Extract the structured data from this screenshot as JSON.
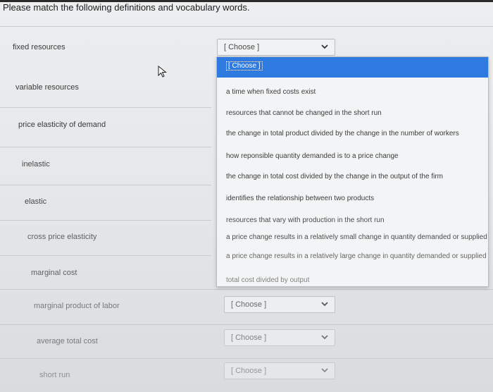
{
  "question": "Please match the following definitions and vocabulary words.",
  "terms": [
    "fixed resources",
    "variable resources",
    "price elasticity of demand",
    "inelastic",
    "elastic",
    "cross price elasticity",
    "marginal cost",
    "marginal product of labor",
    "average total cost",
    "short run"
  ],
  "select_placeholder": "[ Choose ]",
  "dropdown_options": [
    "[ Choose ]",
    "a time when fixed costs exist",
    "resources that cannot be changed in the short run",
    "the change in total product divided by the change in the number of workers",
    "how reponsible quantity demanded is to a price change",
    "the change in total cost divided by the change in the output of the firm",
    "identifies the relationship between two products",
    "resources that vary with production in the short run",
    "a price change results in a relatively small change in quantity demanded or supplied",
    "a price change results in a relatively large change in quantity demanded or supplied",
    "total cost divided by output"
  ],
  "colors": {
    "selected_option": "#2f7ae0"
  },
  "icons": {
    "chevron": "chevron-down-icon",
    "cursor": "mouse-pointer-icon"
  }
}
